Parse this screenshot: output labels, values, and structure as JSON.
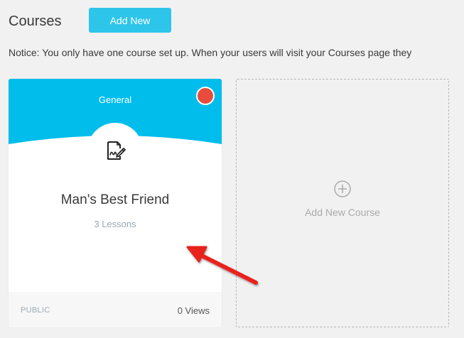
{
  "header": {
    "title": "Courses",
    "add_new_label": "Add New"
  },
  "notice": {
    "text": "Notice: You only have one course set up. When your users will visit your Courses page they"
  },
  "course_card": {
    "category": "General",
    "title": "Man's Best Friend",
    "lessons": "3 Lessons",
    "visibility": "PUBLIC",
    "views": "0 Views",
    "icon": "signed-document-icon",
    "header_color": "#00bdec",
    "status_color": "#e74c3c"
  },
  "add_course_card": {
    "label": "Add New Course",
    "icon": "circle-plus-icon"
  },
  "annotation": {
    "icon": "red-arrow-icon",
    "color": "#e8231c"
  }
}
